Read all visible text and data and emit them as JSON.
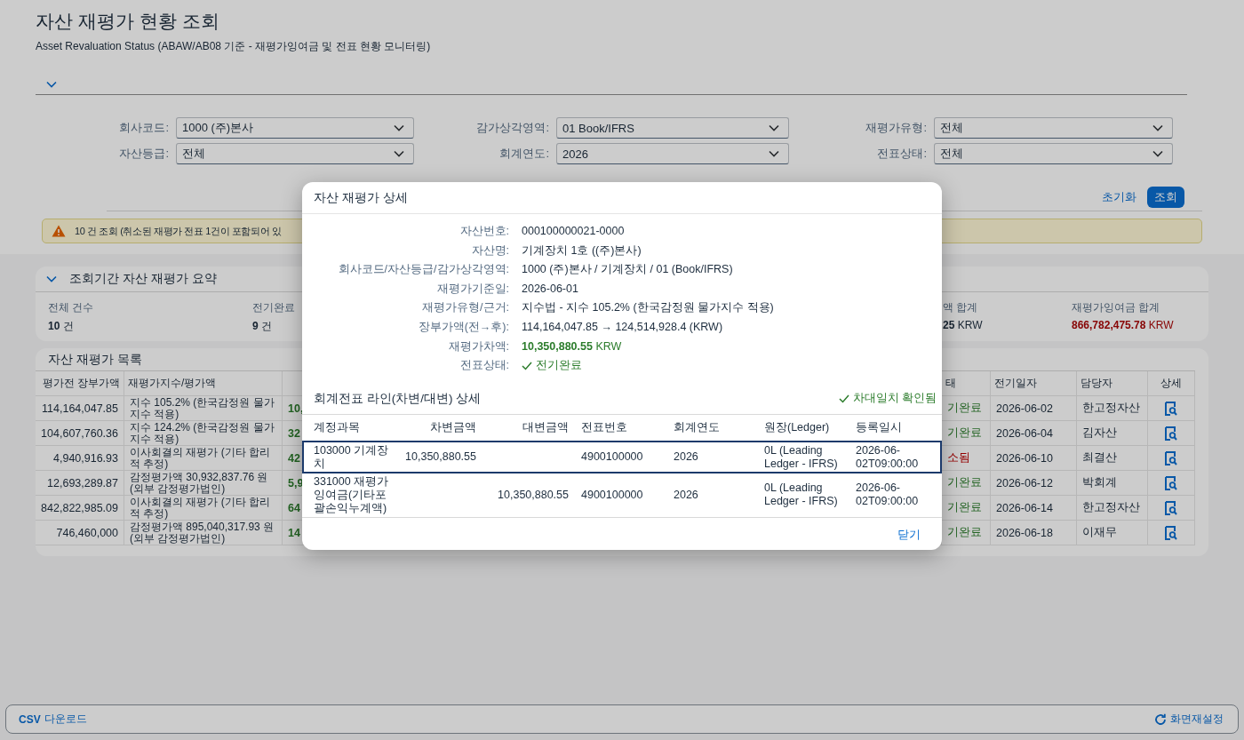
{
  "page": {
    "title": "자산 재평가 현황 조회",
    "subtitle": "Asset Revaluation Status (ABAW/AB08 기준 - 재평가잉여금 및 전표 현황 모니터링)"
  },
  "filter_bar": {
    "expanded": true,
    "fields": [
      {
        "label": "회사코드:",
        "value": "1000 (주)본사"
      },
      {
        "label": "감가상각영역:",
        "value": "01 Book/IFRS"
      },
      {
        "label": "재평가유형:",
        "value": "전체"
      },
      {
        "label": "자산등급:",
        "value": "전체"
      },
      {
        "label": "회계연도:",
        "value": "2026"
      },
      {
        "label": "전표상태:",
        "value": "전체"
      }
    ],
    "buttons": [
      {
        "label": "초기화",
        "kind": "link"
      },
      {
        "label": "조회",
        "kind": "primary"
      }
    ]
  },
  "message": {
    "kind": "warning",
    "text": "10 건 조회 (취소된 재평가 전표 1건이 포함되어 있"
  },
  "summary": {
    "title": "조회기간 자산 재평가 요약",
    "expanded": true,
    "items": [
      {
        "label": "전체 건수",
        "value": "10",
        "unit": "건",
        "kind": "plain"
      },
      {
        "label": "전기완료",
        "value": "9",
        "unit": "건",
        "kind": "plain"
      },
      {
        "label": "액 합계",
        "value": "25",
        "unit": "KRW",
        "kind": "plain"
      },
      {
        "label": "재평가잉여금 합계",
        "value": "866,782,475.78",
        "unit": "KRW",
        "kind": "negative"
      }
    ]
  },
  "table": {
    "title": "자산 재평가 목록",
    "columns": [
      {
        "label": "평가전 장부가액"
      },
      {
        "label": "재평가지수/평가액"
      },
      {
        "label": "태"
      },
      {
        "label": "전기일자"
      },
      {
        "label": "담당자"
      },
      {
        "label": "상세"
      }
    ],
    "rows": [
      {
        "book_value": "114,164,047.85",
        "index": "지수 105.2% (한국감정원 물가지수 적용)",
        "column_3": "10,",
        "status": "기완료",
        "kind": "posted",
        "posting_date": "2026-06-02",
        "owner": "한고정자산"
      },
      {
        "book_value": "104,607,760.36",
        "index": "지수 124.2% (한국감정원 물가지수 적용)",
        "column_3": "32",
        "status": "기완료",
        "kind": "posted",
        "posting_date": "2026-06-04",
        "owner": "김자산"
      },
      {
        "book_value": "4,940,916.93",
        "index": "이사회결의 재평가 (기타 합리적 추정)",
        "column_3": "42",
        "status": "소됨",
        "kind": "cancelled",
        "posting_date": "2026-06-10",
        "owner": "최결산"
      },
      {
        "book_value": "12,693,289.87",
        "index": "감정평가액 30,932,837.76 원 (외부 감정평가법인)",
        "column_3": "5,9",
        "status": "기완료",
        "kind": "posted",
        "posting_date": "2026-06-12",
        "owner": "박회계"
      },
      {
        "book_value": "842,822,985.09",
        "index": "이사회결의 재평가 (기타 합리적 추정)",
        "column_3": "64",
        "status": "기완료",
        "kind": "posted",
        "posting_date": "2026-06-14",
        "owner": "한고정자산"
      },
      {
        "book_value": "746,460,000",
        "index": "감정평가액 895,040,317.93 원 (외부 감정평가법인)",
        "column_3": "14",
        "status": "기완료",
        "kind": "posted",
        "posting_date": "2026-06-18",
        "owner": "이재무"
      }
    ]
  },
  "dialog": {
    "title": "자산 재평가 상세",
    "fields": [
      {
        "label": "자산번호:",
        "value": "000100000021-0000",
        "kind": "text"
      },
      {
        "label": "자산명:",
        "value": "기계장치 1호 ((주)본사)",
        "kind": "text"
      },
      {
        "label": "회사코드/자산등급/감가상각영역:",
        "value": "1000 (주)본사 / 기계장치 / 01 (Book/IFRS)",
        "kind": "text"
      },
      {
        "label": "재평가기준일:",
        "value": "2026-06-01",
        "kind": "text"
      },
      {
        "label": "재평가유형/근거:",
        "value": "지수법 - 지수 105.2% (한국감정원 물가지수 적용)",
        "kind": "text"
      },
      {
        "label": "장부가액(전→후):",
        "value": "114,164,047.85 → 124,514,928.4 (KRW)",
        "kind": "text"
      },
      {
        "label": "재평가차액:",
        "value": "10,350,880.55",
        "unit": "KRW",
        "kind": "amount"
      },
      {
        "label": "전표상태:",
        "value": "전기완료",
        "kind": "status"
      }
    ],
    "lines_title": "회계전표 라인(차변/대변) 상세",
    "balance_status": {
      "text": "차대일치 확인됨",
      "kind": "success"
    },
    "lines_columns": [
      "계정과목",
      "차변금액",
      "대변금액",
      "전표번호",
      "회계연도",
      "원장(Ledger)",
      "등록일시"
    ],
    "lines": [
      {
        "account": "103000 기계장치",
        "debit": "10,350,880.55",
        "document": "4900100000",
        "year": "2026",
        "ledger": "0L (Leading Ledger - IFRS)",
        "created": "2026-06-02T09:00:00",
        "selected": true
      },
      {
        "account": "331000 재평가잉여금(기타포괄손익누계액)",
        "credit": "10,350,880.55",
        "document": "4900100000",
        "year": "2026",
        "ledger": "0L (Leading Ledger - IFRS)",
        "created": "2026-06-02T09:00:00",
        "selected": false
      }
    ],
    "close_button": "닫기"
  },
  "footer": {
    "download": "**CSV** 다운로드",
    "reset": "화면재설정"
  }
}
